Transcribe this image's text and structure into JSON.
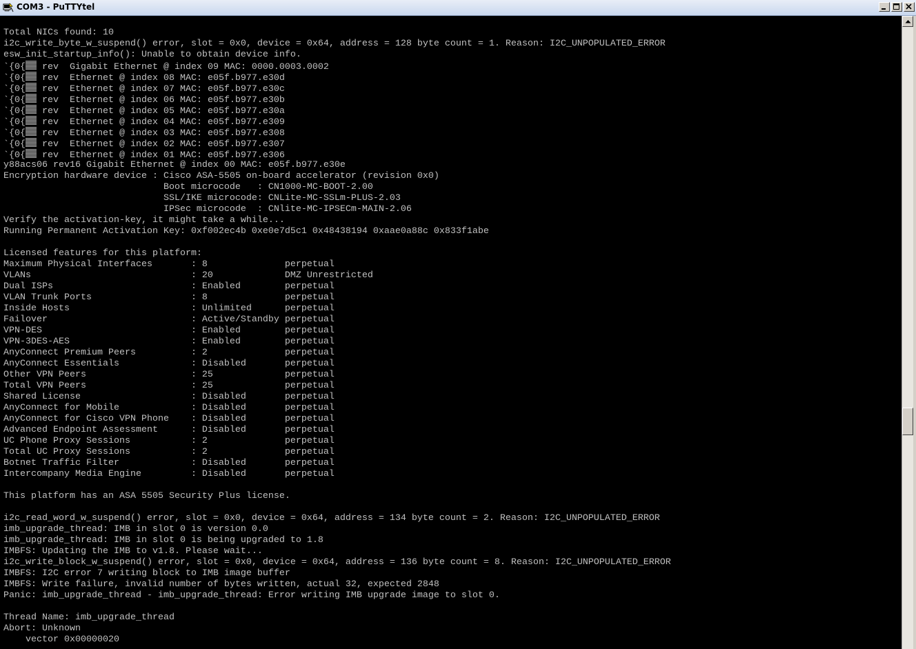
{
  "window": {
    "title": "COM3 - PuTTYtel",
    "icon": "putty-terminal-icon",
    "controls": [
      "minimize-icon",
      "maximize-icon",
      "close-icon"
    ]
  },
  "terminal": {
    "text_color": "#c0c0c0",
    "background": "#000000",
    "lines": [
      {
        "text": "Total NICs found: 10"
      },
      {
        "text": "i2c_write_byte_w_suspend() error, slot = 0x0, device = 0x64, address = 128 byte count = 1. Reason: I2C_UNPOPULATED_ERROR"
      },
      {
        "text": "esw_init_startup_info(): Unable to obtain device info."
      },
      {
        "prefix": "`{0{",
        "garbled": true,
        "text": " rev  Gigabit Ethernet @ index 09 MAC: 0000.0003.0002"
      },
      {
        "prefix": "`{0{",
        "garbled": true,
        "text": " rev  Ethernet @ index 08 MAC: e05f.b977.e30d"
      },
      {
        "prefix": "`{0{",
        "garbled": true,
        "text": " rev  Ethernet @ index 07 MAC: e05f.b977.e30c"
      },
      {
        "prefix": "`{0{",
        "garbled": true,
        "text": " rev  Ethernet @ index 06 MAC: e05f.b977.e30b"
      },
      {
        "prefix": "`{0{",
        "garbled": true,
        "text": " rev  Ethernet @ index 05 MAC: e05f.b977.e30a"
      },
      {
        "prefix": "`{0{",
        "garbled": true,
        "text": " rev  Ethernet @ index 04 MAC: e05f.b977.e309"
      },
      {
        "prefix": "`{0{",
        "garbled": true,
        "text": " rev  Ethernet @ index 03 MAC: e05f.b977.e308"
      },
      {
        "prefix": "`{0{",
        "garbled": true,
        "text": " rev  Ethernet @ index 02 MAC: e05f.b977.e307"
      },
      {
        "prefix": "`{0{",
        "garbled": true,
        "text": " rev  Ethernet @ index 01 MAC: e05f.b977.e306"
      },
      {
        "text": "y88acs06 rev16 Gigabit Ethernet @ index 00 MAC: e05f.b977.e30e"
      },
      {
        "text": "Encryption hardware device : Cisco ASA-5505 on-board accelerator (revision 0x0)"
      },
      {
        "text": "                             Boot microcode   : CN1000-MC-BOOT-2.00"
      },
      {
        "text": "                             SSL/IKE microcode: CNLite-MC-SSLm-PLUS-2.03"
      },
      {
        "text": "                             IPSec microcode  : CNlite-MC-IPSECm-MAIN-2.06"
      },
      {
        "text": "Verify the activation-key, it might take a while..."
      },
      {
        "text": "Running Permanent Activation Key: 0xf002ec4b 0xe0e7d5c1 0x48438194 0xaae0a88c 0x833f1abe"
      },
      {
        "text": ""
      },
      {
        "text": "Licensed features for this platform:"
      },
      {
        "text": "Maximum Physical Interfaces       : 8              perpetual"
      },
      {
        "text": "VLANs                             : 20             DMZ Unrestricted"
      },
      {
        "text": "Dual ISPs                         : Enabled        perpetual"
      },
      {
        "text": "VLAN Trunk Ports                  : 8              perpetual"
      },
      {
        "text": "Inside Hosts                      : Unlimited      perpetual"
      },
      {
        "text": "Failover                          : Active/Standby perpetual"
      },
      {
        "text": "VPN-DES                           : Enabled        perpetual"
      },
      {
        "text": "VPN-3DES-AES                      : Enabled        perpetual"
      },
      {
        "text": "AnyConnect Premium Peers          : 2              perpetual"
      },
      {
        "text": "AnyConnect Essentials             : Disabled       perpetual"
      },
      {
        "text": "Other VPN Peers                   : 25             perpetual"
      },
      {
        "text": "Total VPN Peers                   : 25             perpetual"
      },
      {
        "text": "Shared License                    : Disabled       perpetual"
      },
      {
        "text": "AnyConnect for Mobile             : Disabled       perpetual"
      },
      {
        "text": "AnyConnect for Cisco VPN Phone    : Disabled       perpetual"
      },
      {
        "text": "Advanced Endpoint Assessment      : Disabled       perpetual"
      },
      {
        "text": "UC Phone Proxy Sessions           : 2              perpetual"
      },
      {
        "text": "Total UC Proxy Sessions           : 2              perpetual"
      },
      {
        "text": "Botnet Traffic Filter             : Disabled       perpetual"
      },
      {
        "text": "Intercompany Media Engine         : Disabled       perpetual"
      },
      {
        "text": ""
      },
      {
        "text": "This platform has an ASA 5505 Security Plus license."
      },
      {
        "text": ""
      },
      {
        "text": "i2c_read_word_w_suspend() error, slot = 0x0, device = 0x64, address = 134 byte count = 2. Reason: I2C_UNPOPULATED_ERROR"
      },
      {
        "text": "imb_upgrade_thread: IMB in slot 0 is version 0.0"
      },
      {
        "text": "imb_upgrade_thread: IMB in slot 0 is being upgraded to 1.8"
      },
      {
        "text": "IMBFS: Updating the IMB to v1.8. Please wait..."
      },
      {
        "text": "i2c_write_block_w_suspend() error, slot = 0x0, device = 0x64, address = 136 byte count = 8. Reason: I2C_UNPOPULATED_ERROR"
      },
      {
        "text": "IMBFS: I2C error 7 writing block to IMB image buffer"
      },
      {
        "text": "IMBFS: Write failure, invalid number of bytes written, actual 32, expected 2848"
      },
      {
        "text": "Panic: imb_upgrade_thread - imb_upgrade_thread: Error writing IMB upgrade image to slot 0."
      },
      {
        "text": ""
      },
      {
        "text": "Thread Name: imb_upgrade_thread"
      },
      {
        "text": "Abort: Unknown"
      },
      {
        "text": "    vector 0x00000020"
      }
    ]
  },
  "scrollbar": {
    "up_icon": "scroll-up-arrow-icon",
    "position_fraction": 0.64
  }
}
